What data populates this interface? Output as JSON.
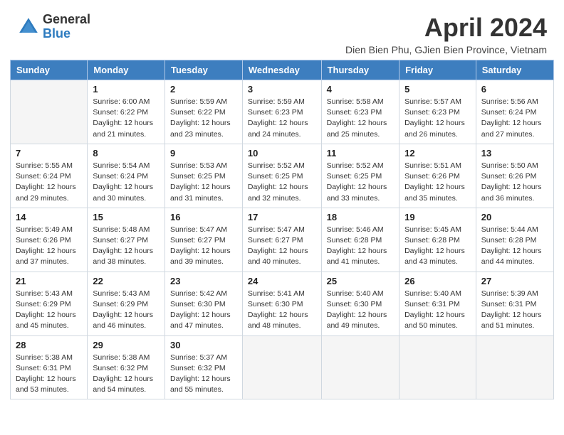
{
  "header": {
    "logo_general": "General",
    "logo_blue": "Blue",
    "title": "April 2024",
    "subtitle": "Dien Bien Phu, GJien Bien Province, Vietnam"
  },
  "days": [
    "Sunday",
    "Monday",
    "Tuesday",
    "Wednesday",
    "Thursday",
    "Friday",
    "Saturday"
  ],
  "weeks": [
    [
      {
        "num": "",
        "sunrise": "",
        "sunset": "",
        "daylight": ""
      },
      {
        "num": "1",
        "sunrise": "Sunrise: 6:00 AM",
        "sunset": "Sunset: 6:22 PM",
        "daylight": "Daylight: 12 hours and 21 minutes."
      },
      {
        "num": "2",
        "sunrise": "Sunrise: 5:59 AM",
        "sunset": "Sunset: 6:22 PM",
        "daylight": "Daylight: 12 hours and 23 minutes."
      },
      {
        "num": "3",
        "sunrise": "Sunrise: 5:59 AM",
        "sunset": "Sunset: 6:23 PM",
        "daylight": "Daylight: 12 hours and 24 minutes."
      },
      {
        "num": "4",
        "sunrise": "Sunrise: 5:58 AM",
        "sunset": "Sunset: 6:23 PM",
        "daylight": "Daylight: 12 hours and 25 minutes."
      },
      {
        "num": "5",
        "sunrise": "Sunrise: 5:57 AM",
        "sunset": "Sunset: 6:23 PM",
        "daylight": "Daylight: 12 hours and 26 minutes."
      },
      {
        "num": "6",
        "sunrise": "Sunrise: 5:56 AM",
        "sunset": "Sunset: 6:24 PM",
        "daylight": "Daylight: 12 hours and 27 minutes."
      }
    ],
    [
      {
        "num": "7",
        "sunrise": "Sunrise: 5:55 AM",
        "sunset": "Sunset: 6:24 PM",
        "daylight": "Daylight: 12 hours and 29 minutes."
      },
      {
        "num": "8",
        "sunrise": "Sunrise: 5:54 AM",
        "sunset": "Sunset: 6:24 PM",
        "daylight": "Daylight: 12 hours and 30 minutes."
      },
      {
        "num": "9",
        "sunrise": "Sunrise: 5:53 AM",
        "sunset": "Sunset: 6:25 PM",
        "daylight": "Daylight: 12 hours and 31 minutes."
      },
      {
        "num": "10",
        "sunrise": "Sunrise: 5:52 AM",
        "sunset": "Sunset: 6:25 PM",
        "daylight": "Daylight: 12 hours and 32 minutes."
      },
      {
        "num": "11",
        "sunrise": "Sunrise: 5:52 AM",
        "sunset": "Sunset: 6:25 PM",
        "daylight": "Daylight: 12 hours and 33 minutes."
      },
      {
        "num": "12",
        "sunrise": "Sunrise: 5:51 AM",
        "sunset": "Sunset: 6:26 PM",
        "daylight": "Daylight: 12 hours and 35 minutes."
      },
      {
        "num": "13",
        "sunrise": "Sunrise: 5:50 AM",
        "sunset": "Sunset: 6:26 PM",
        "daylight": "Daylight: 12 hours and 36 minutes."
      }
    ],
    [
      {
        "num": "14",
        "sunrise": "Sunrise: 5:49 AM",
        "sunset": "Sunset: 6:26 PM",
        "daylight": "Daylight: 12 hours and 37 minutes."
      },
      {
        "num": "15",
        "sunrise": "Sunrise: 5:48 AM",
        "sunset": "Sunset: 6:27 PM",
        "daylight": "Daylight: 12 hours and 38 minutes."
      },
      {
        "num": "16",
        "sunrise": "Sunrise: 5:47 AM",
        "sunset": "Sunset: 6:27 PM",
        "daylight": "Daylight: 12 hours and 39 minutes."
      },
      {
        "num": "17",
        "sunrise": "Sunrise: 5:47 AM",
        "sunset": "Sunset: 6:27 PM",
        "daylight": "Daylight: 12 hours and 40 minutes."
      },
      {
        "num": "18",
        "sunrise": "Sunrise: 5:46 AM",
        "sunset": "Sunset: 6:28 PM",
        "daylight": "Daylight: 12 hours and 41 minutes."
      },
      {
        "num": "19",
        "sunrise": "Sunrise: 5:45 AM",
        "sunset": "Sunset: 6:28 PM",
        "daylight": "Daylight: 12 hours and 43 minutes."
      },
      {
        "num": "20",
        "sunrise": "Sunrise: 5:44 AM",
        "sunset": "Sunset: 6:28 PM",
        "daylight": "Daylight: 12 hours and 44 minutes."
      }
    ],
    [
      {
        "num": "21",
        "sunrise": "Sunrise: 5:43 AM",
        "sunset": "Sunset: 6:29 PM",
        "daylight": "Daylight: 12 hours and 45 minutes."
      },
      {
        "num": "22",
        "sunrise": "Sunrise: 5:43 AM",
        "sunset": "Sunset: 6:29 PM",
        "daylight": "Daylight: 12 hours and 46 minutes."
      },
      {
        "num": "23",
        "sunrise": "Sunrise: 5:42 AM",
        "sunset": "Sunset: 6:30 PM",
        "daylight": "Daylight: 12 hours and 47 minutes."
      },
      {
        "num": "24",
        "sunrise": "Sunrise: 5:41 AM",
        "sunset": "Sunset: 6:30 PM",
        "daylight": "Daylight: 12 hours and 48 minutes."
      },
      {
        "num": "25",
        "sunrise": "Sunrise: 5:40 AM",
        "sunset": "Sunset: 6:30 PM",
        "daylight": "Daylight: 12 hours and 49 minutes."
      },
      {
        "num": "26",
        "sunrise": "Sunrise: 5:40 AM",
        "sunset": "Sunset: 6:31 PM",
        "daylight": "Daylight: 12 hours and 50 minutes."
      },
      {
        "num": "27",
        "sunrise": "Sunrise: 5:39 AM",
        "sunset": "Sunset: 6:31 PM",
        "daylight": "Daylight: 12 hours and 51 minutes."
      }
    ],
    [
      {
        "num": "28",
        "sunrise": "Sunrise: 5:38 AM",
        "sunset": "Sunset: 6:31 PM",
        "daylight": "Daylight: 12 hours and 53 minutes."
      },
      {
        "num": "29",
        "sunrise": "Sunrise: 5:38 AM",
        "sunset": "Sunset: 6:32 PM",
        "daylight": "Daylight: 12 hours and 54 minutes."
      },
      {
        "num": "30",
        "sunrise": "Sunrise: 5:37 AM",
        "sunset": "Sunset: 6:32 PM",
        "daylight": "Daylight: 12 hours and 55 minutes."
      },
      {
        "num": "",
        "sunrise": "",
        "sunset": "",
        "daylight": ""
      },
      {
        "num": "",
        "sunrise": "",
        "sunset": "",
        "daylight": ""
      },
      {
        "num": "",
        "sunrise": "",
        "sunset": "",
        "daylight": ""
      },
      {
        "num": "",
        "sunrise": "",
        "sunset": "",
        "daylight": ""
      }
    ]
  ]
}
